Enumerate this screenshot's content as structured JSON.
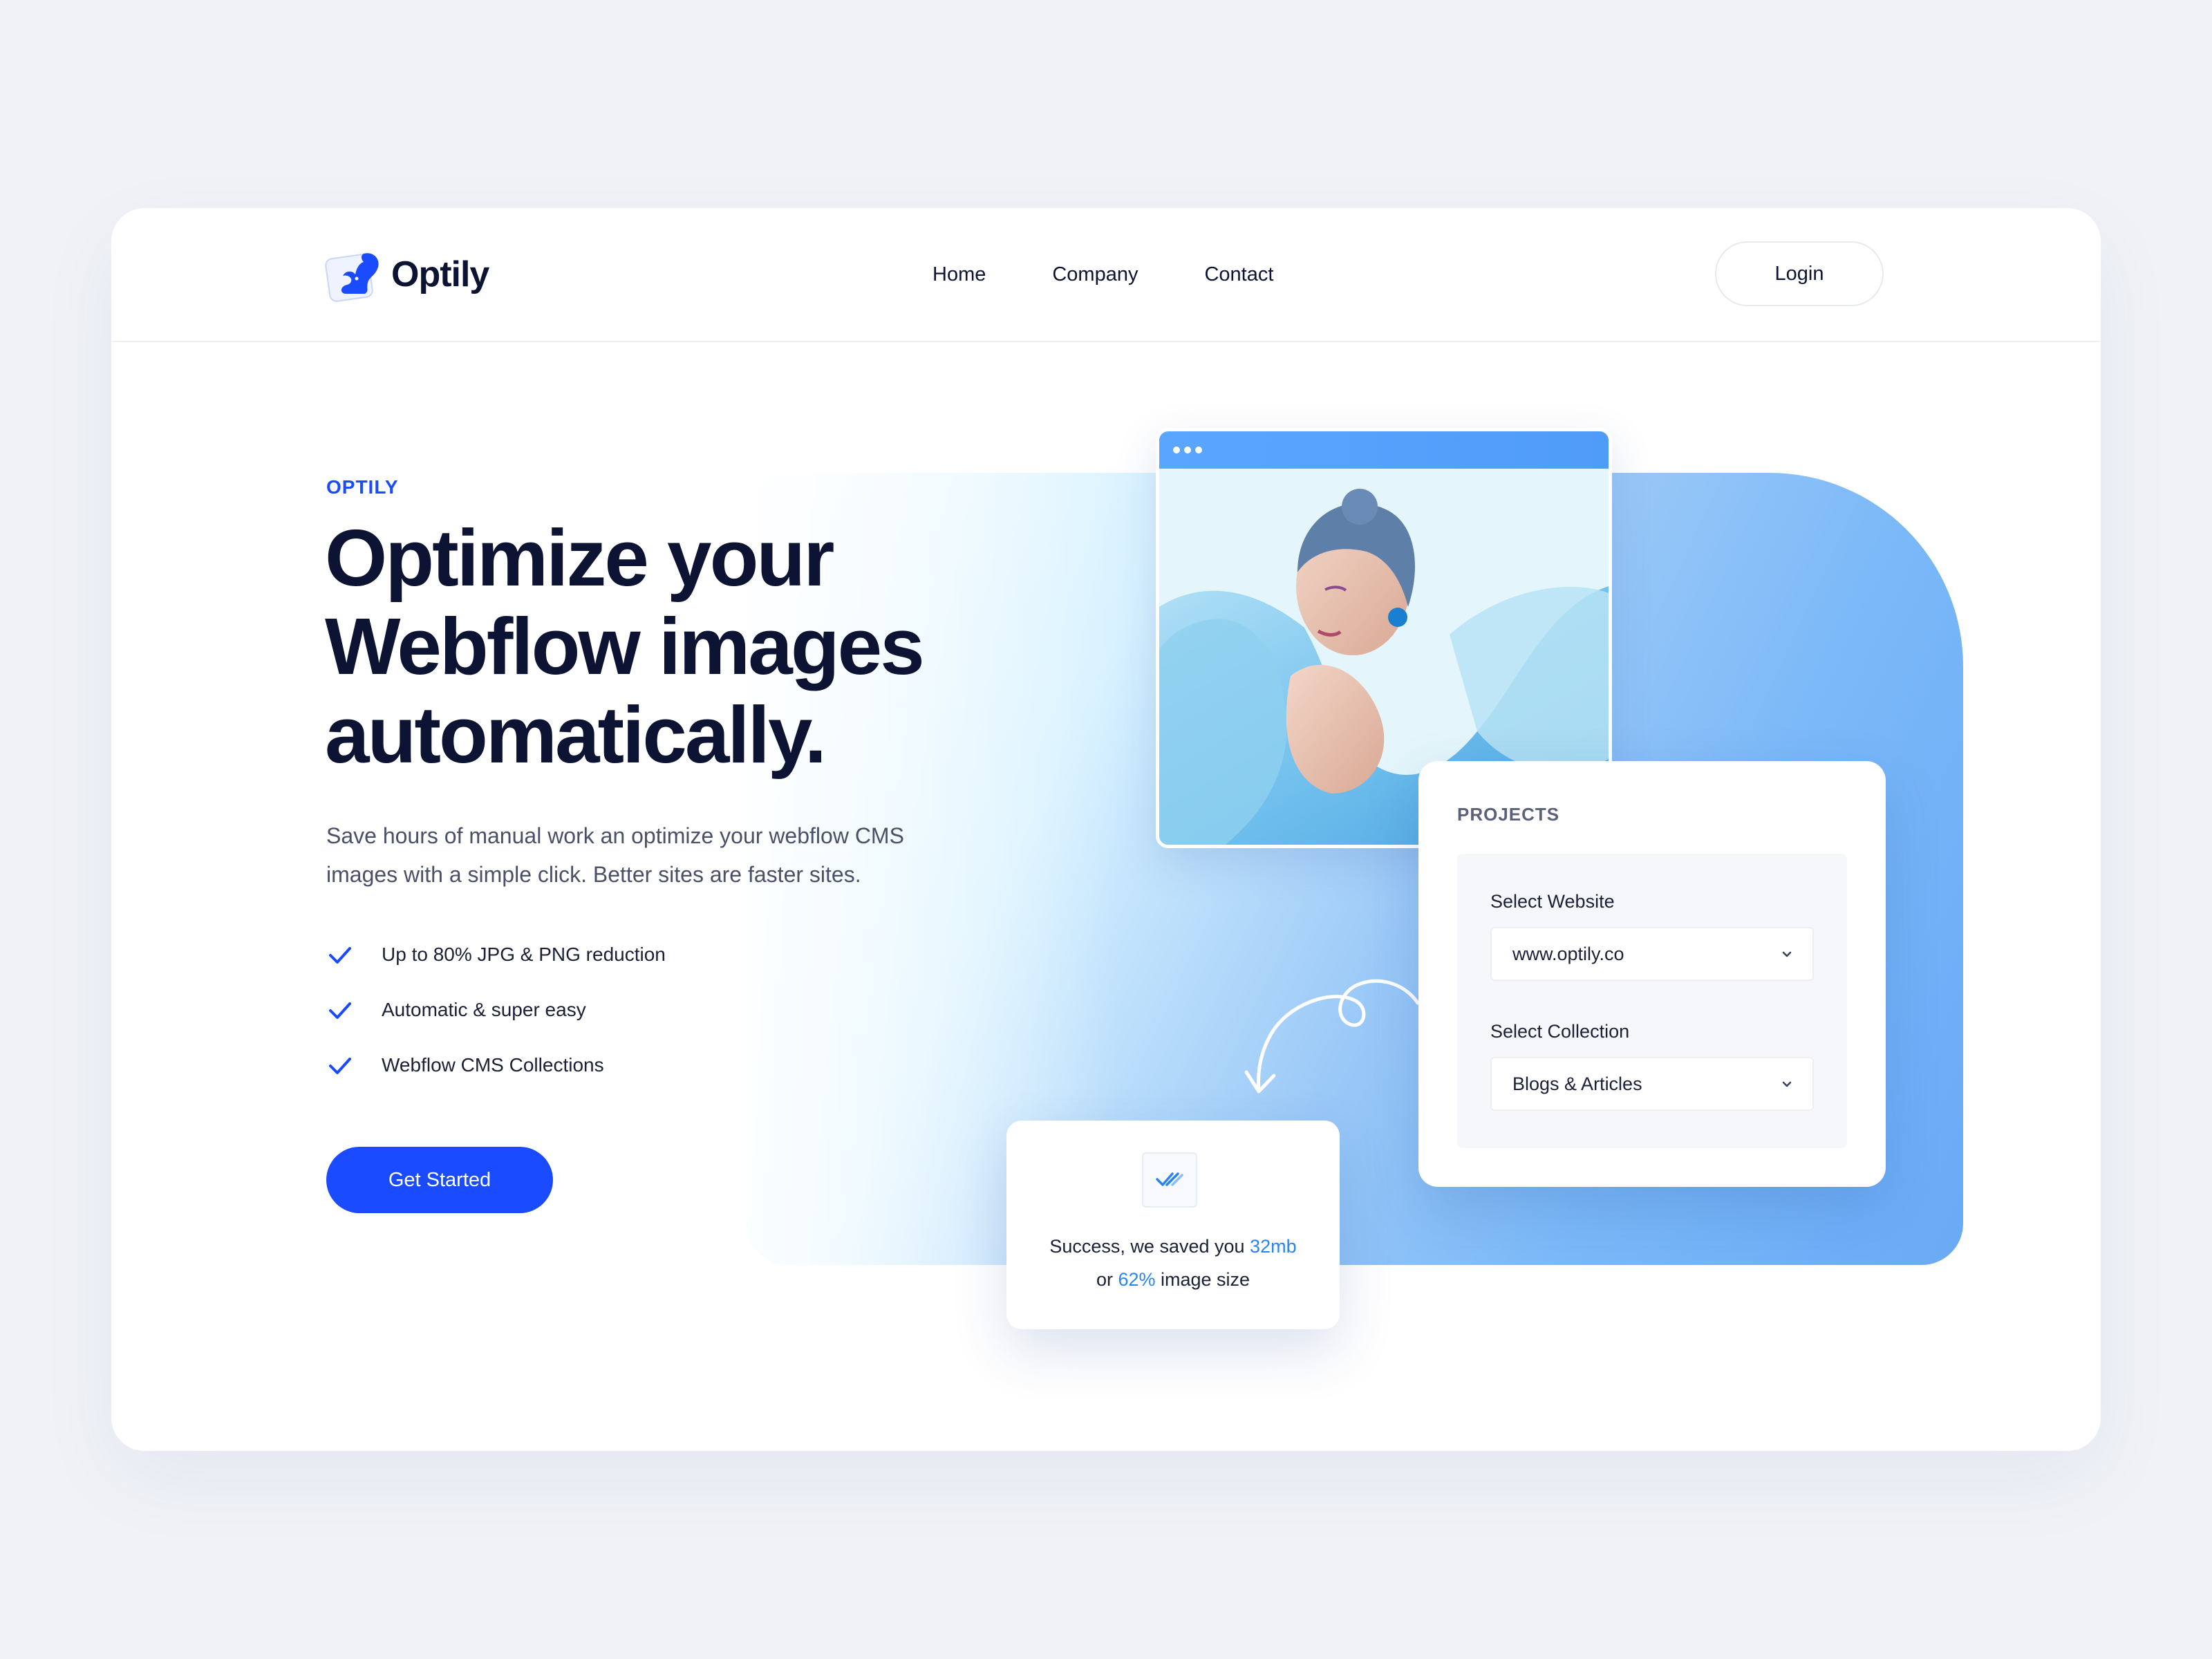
{
  "nav": {
    "logo_text": "Optily",
    "links": [
      "Home",
      "Company",
      "Contact"
    ],
    "login_label": "Login"
  },
  "hero": {
    "eyebrow": "OPTILY",
    "headline_line1": "Optimize your",
    "headline_line2": "Webflow images",
    "headline_line3": "automatically.",
    "subtext": "Save hours of manual work an optimize your webflow CMS images with a simple click. Better sites are faster sites.",
    "features": [
      "Up to 80% JPG & PNG reduction",
      "Automatic & super easy",
      "Webflow CMS Collections"
    ],
    "cta_label": "Get Started"
  },
  "projects": {
    "title": "PROJECTS",
    "website_label": "Select Website",
    "website_value": "www.optily.co",
    "collection_label": "Select Collection",
    "collection_value": "Blogs & Articles"
  },
  "success": {
    "text_a": "Success, we saved you ",
    "saved_size": "32mb",
    "text_b": "or ",
    "saved_percent": "62%",
    "text_c": " image size"
  },
  "colors": {
    "brand": "#1a4bff",
    "accent": "#2a84f0",
    "ink": "#0d1433",
    "page_bg": "#f0f2f7"
  },
  "icons": [
    "squirrel-logo-icon",
    "check-icon",
    "chevron-down-icon",
    "double-check-icon",
    "curly-arrow-icon"
  ]
}
